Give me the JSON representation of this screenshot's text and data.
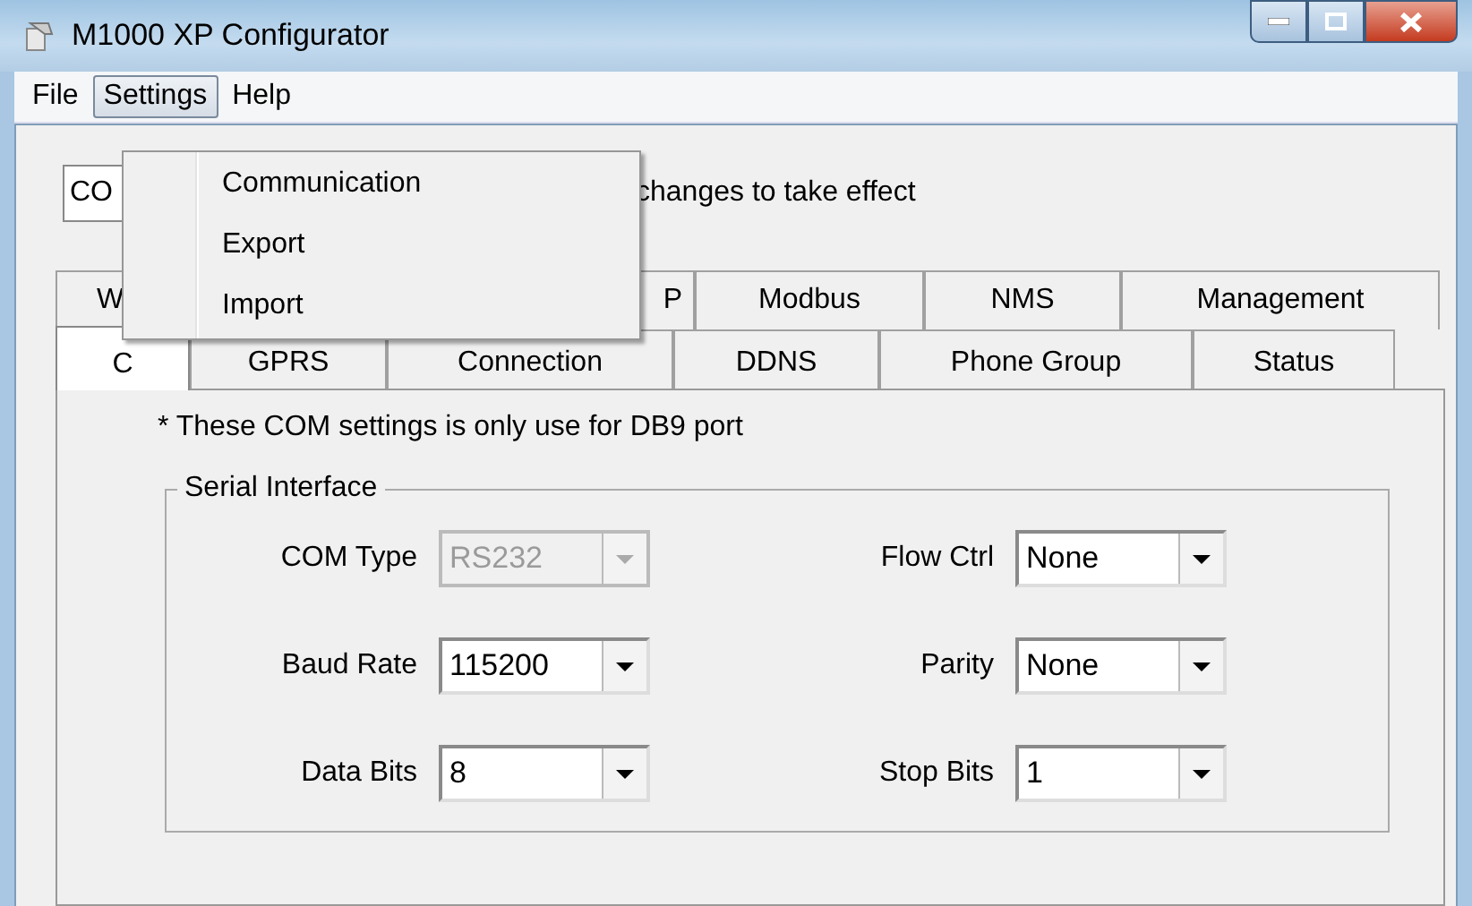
{
  "window": {
    "title": "M1000 XP Configurator"
  },
  "menu_bar": [
    {
      "label": "File",
      "selected": false
    },
    {
      "label": "Settings",
      "selected": true
    },
    {
      "label": "Help",
      "selected": false
    }
  ],
  "open_menu": {
    "items": [
      "Communication",
      "Export",
      "Import"
    ]
  },
  "notice": {
    "field_value": "CO",
    "text": "changes to take effect"
  },
  "tab_rows": [
    [
      {
        "label": "W",
        "selected": false
      },
      {
        "label": "P",
        "selected": false
      },
      {
        "label": "Modbus",
        "selected": false
      },
      {
        "label": "NMS",
        "selected": false
      },
      {
        "label": "Management",
        "selected": false
      }
    ],
    [
      {
        "label": "C",
        "selected": true
      },
      {
        "label": "GPRS",
        "selected": false
      },
      {
        "label": "Connection",
        "selected": false
      },
      {
        "label": "DDNS",
        "selected": false
      },
      {
        "label": "Phone Group",
        "selected": false
      },
      {
        "label": "Status",
        "selected": false
      }
    ]
  ],
  "note": "* These COM settings is only use for DB9 port",
  "serial_interface": {
    "title": "Serial Interface",
    "fields": [
      {
        "label": "COM Type",
        "value": "RS232",
        "disabled": true
      },
      {
        "label": "Flow Ctrl",
        "value": "None",
        "disabled": false
      },
      {
        "label": "Baud Rate",
        "value": "115200",
        "disabled": false
      },
      {
        "label": "Parity",
        "value": "None",
        "disabled": false
      },
      {
        "label": "Data Bits",
        "value": "8",
        "disabled": false
      },
      {
        "label": "Stop Bits",
        "value": "1",
        "disabled": false
      }
    ]
  }
}
